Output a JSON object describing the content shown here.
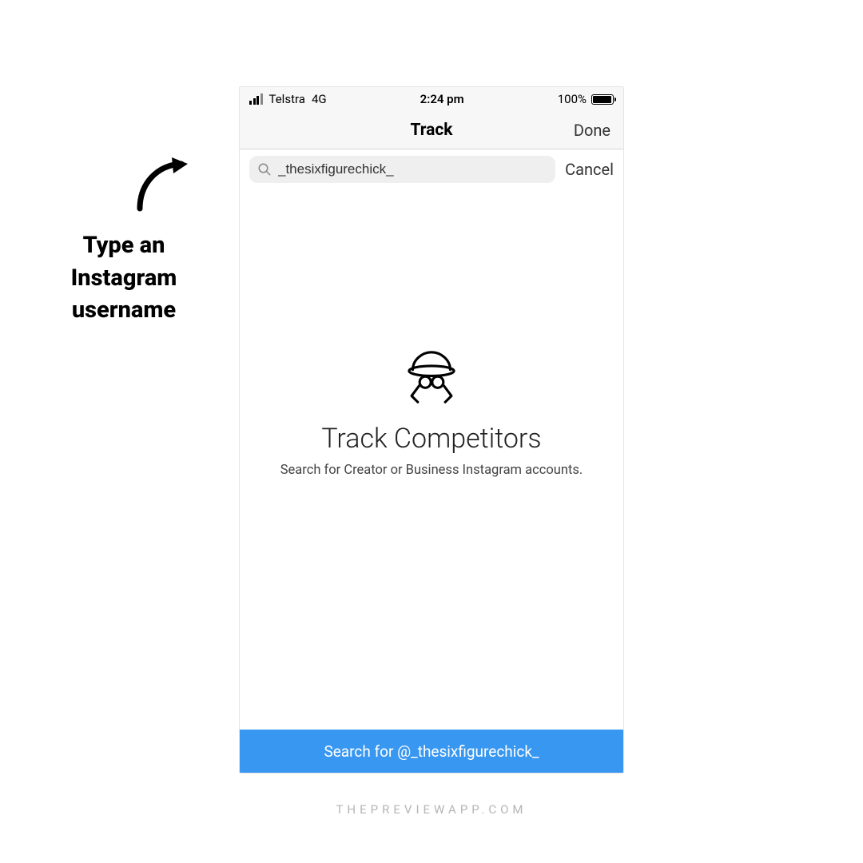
{
  "annotation": {
    "text_line1": "Type an",
    "text_line2": "Instagram",
    "text_line3": "username"
  },
  "status_bar": {
    "carrier": "Telstra",
    "network": "4G",
    "time": "2:24 pm",
    "battery_pct": "100%"
  },
  "nav": {
    "title": "Track",
    "done_label": "Done"
  },
  "search": {
    "value": "_thesixfigurechick_",
    "cancel_label": "Cancel"
  },
  "empty_state": {
    "title": "Track Competitors",
    "subtitle": "Search for Creator or Business Instagram accounts."
  },
  "cta": {
    "label": "Search for @_thesixfigurechick_"
  },
  "watermark": "THEPREVIEWAPP.COM",
  "colors": {
    "cta_bg": "#3897f0"
  }
}
